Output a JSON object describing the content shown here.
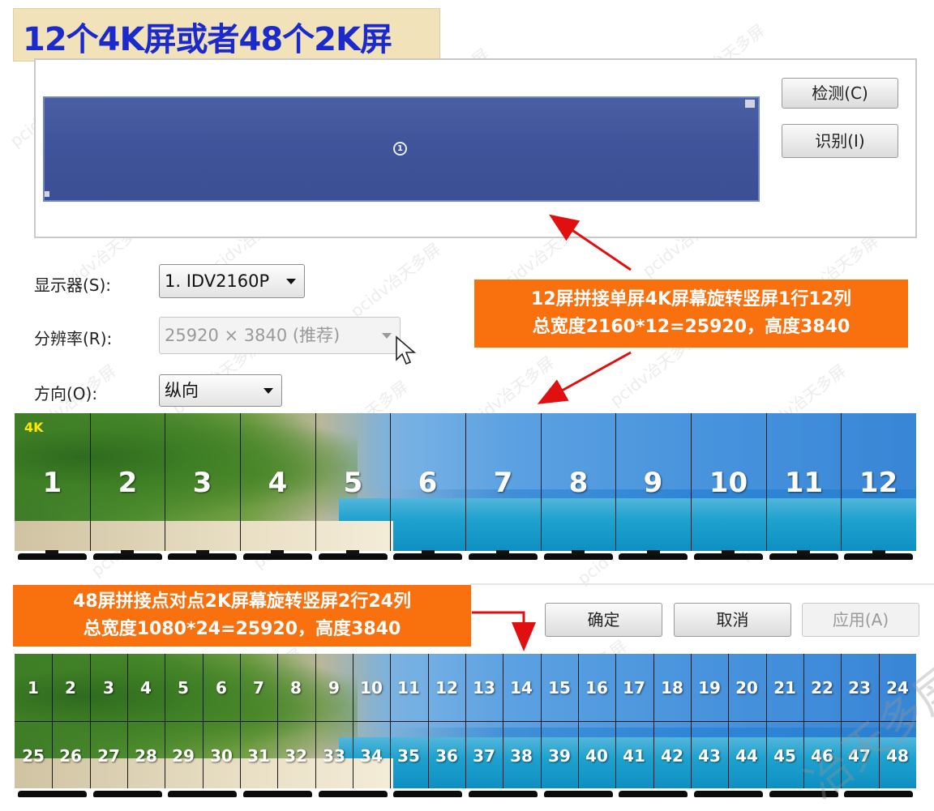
{
  "title": "12个4K屏或者48个2K屏",
  "preview": {
    "monitor_number": "1"
  },
  "buttons": {
    "detect": "检测(C)",
    "identify": "识别(I)",
    "ok": "确定",
    "cancel": "取消",
    "apply": "应用(A)"
  },
  "settings": {
    "display_label": "显示器(S):",
    "display_value": "1. IDV2160P",
    "resolution_label": "分辨率(R):",
    "resolution_value": "25920 × 3840 (推荐)",
    "orientation_label": "方向(O):",
    "orientation_value": "纵向"
  },
  "callout_top": {
    "line1": "12屏拼接单屏4K屏幕旋转竖屏1行12列",
    "line2": "总宽度2160*12=25920，高度3840"
  },
  "callout_bottom": {
    "line1": "48屏拼接点对点2K屏幕旋转竖屏2行24列",
    "line2": "总宽度1080*24=25920，高度3840"
  },
  "wall_top": {
    "badge": "4K",
    "numbers": [
      "1",
      "2",
      "3",
      "4",
      "5",
      "6",
      "7",
      "8",
      "9",
      "10",
      "11",
      "12"
    ]
  },
  "wall_bottom": {
    "row1": [
      "1",
      "2",
      "3",
      "4",
      "5",
      "6",
      "7",
      "8",
      "9",
      "10",
      "11",
      "12",
      "13",
      "14",
      "15",
      "16",
      "17",
      "18",
      "19",
      "20",
      "21",
      "22",
      "23",
      "24"
    ],
    "row2": [
      "25",
      "26",
      "27",
      "28",
      "29",
      "30",
      "31",
      "32",
      "33",
      "34",
      "35",
      "36",
      "37",
      "38",
      "39",
      "40",
      "41",
      "42",
      "43",
      "44",
      "45",
      "46",
      "47",
      "48"
    ]
  },
  "watermark": "pcidv冶天多屏",
  "corner_watermark": "冶天多屏",
  "colors": {
    "accent_orange": "#f9700e",
    "title_blue": "#1a2acc",
    "arrow_red": "#e01010",
    "badge_yellow": "#ffe800"
  }
}
